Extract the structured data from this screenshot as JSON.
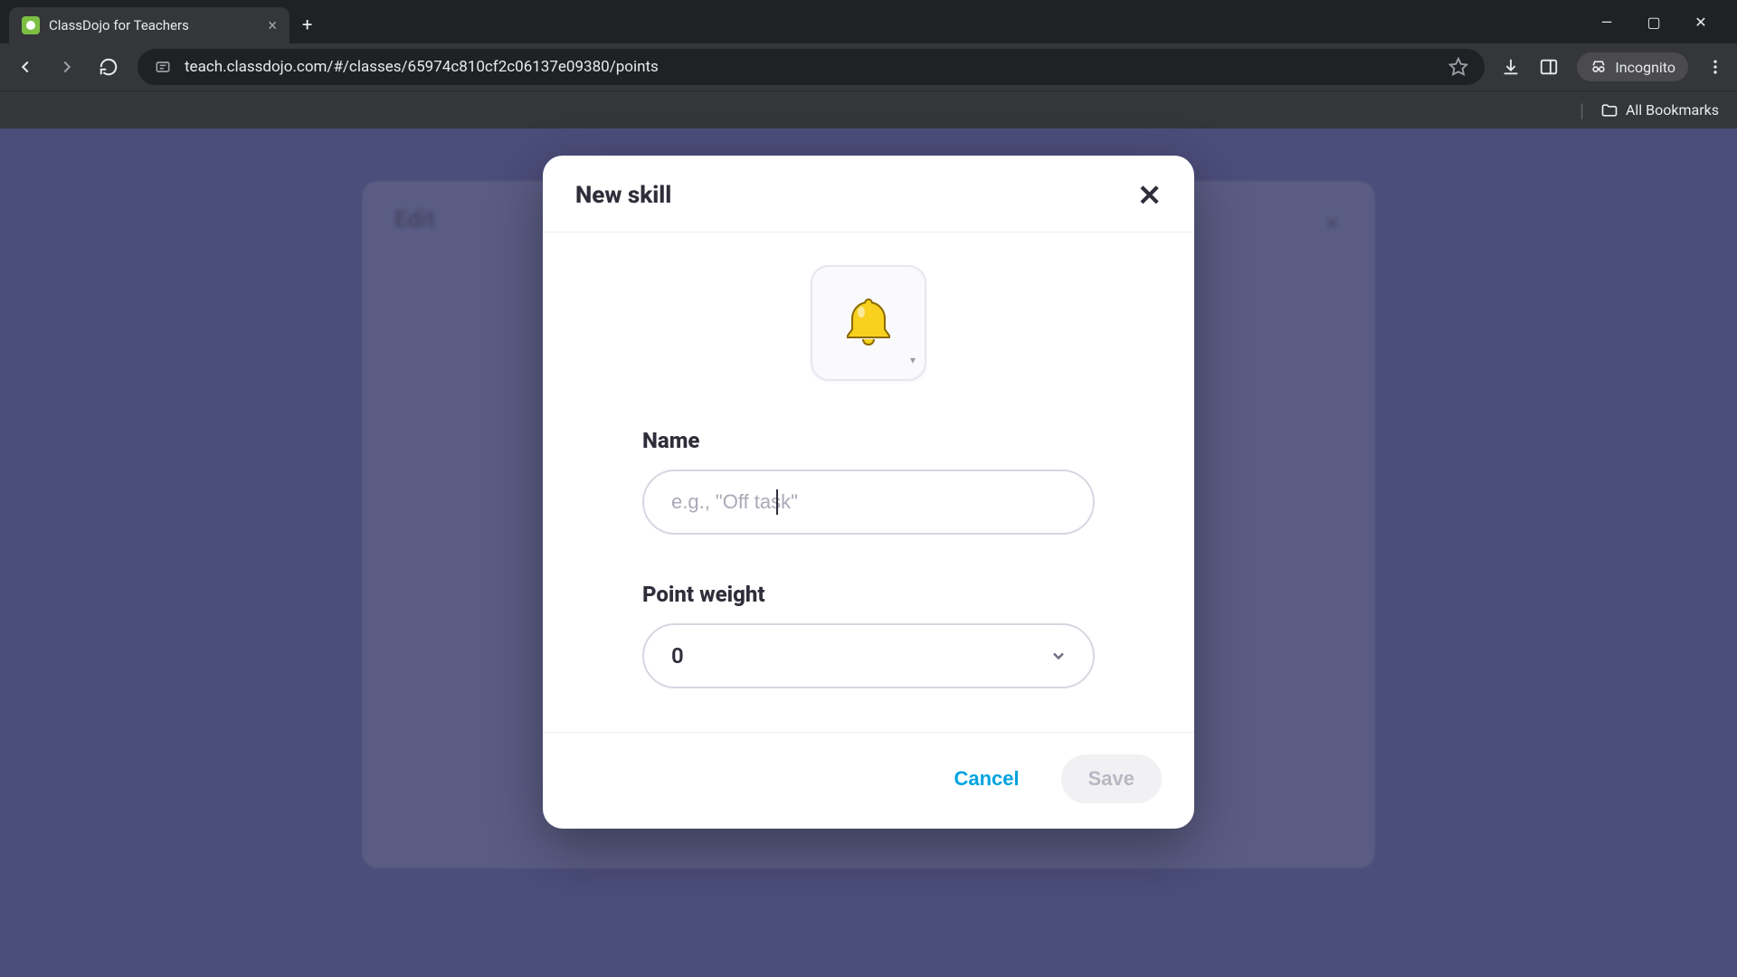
{
  "browser": {
    "tab_title": "ClassDojo for Teachers",
    "url": "teach.classdojo.com/#/classes/65974c810cf2c06137e09380/points",
    "incognito_label": "Incognito",
    "all_bookmarks_label": "All Bookmarks"
  },
  "backdrop": {
    "title": "Edit"
  },
  "modal": {
    "title": "New skill",
    "name_label": "Name",
    "name_placeholder": "e.g., \"Off task\"",
    "name_value": "",
    "point_weight_label": "Point weight",
    "point_weight_value": "0",
    "cancel_label": "Cancel",
    "save_label": "Save",
    "icon_name": "bell-icon"
  },
  "colors": {
    "page_bg": "#5a5d8f",
    "accent": "#00a3e0"
  }
}
